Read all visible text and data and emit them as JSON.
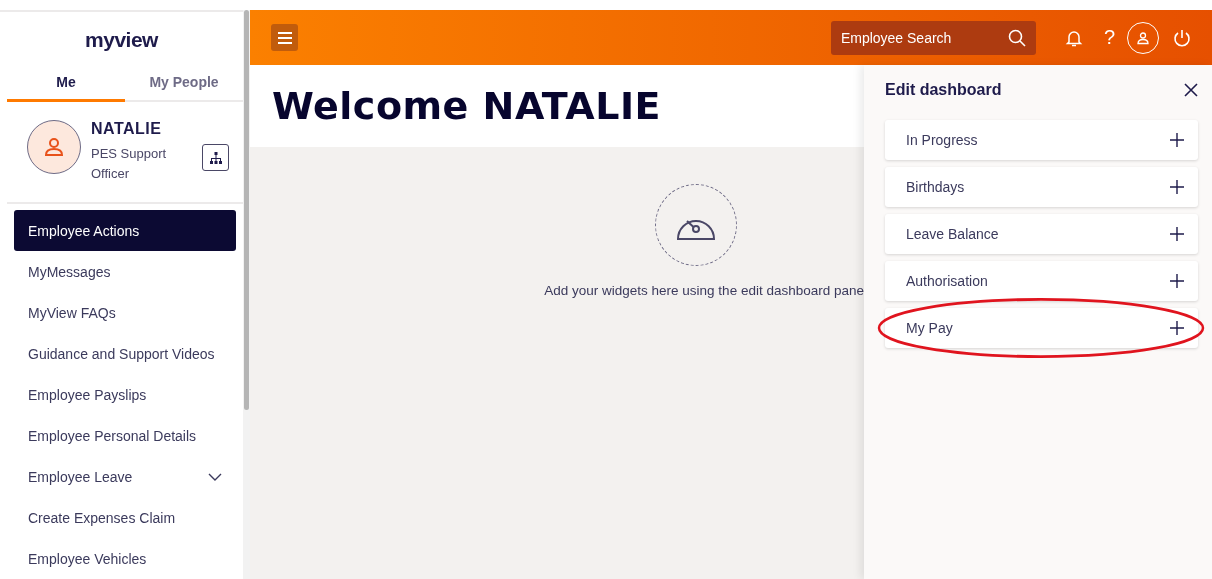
{
  "sidebar": {
    "logo": "myview",
    "tabs": [
      {
        "label": "Me",
        "selected": true
      },
      {
        "label": "My People",
        "selected": false
      }
    ],
    "profile": {
      "name": "NATALIE",
      "role": "PES Support Officer"
    },
    "items": [
      {
        "label": "Employee Actions",
        "selected": true,
        "expandable": false
      },
      {
        "label": "MyMessages",
        "selected": false,
        "expandable": false
      },
      {
        "label": "MyView FAQs",
        "selected": false,
        "expandable": false
      },
      {
        "label": "Guidance and Support Videos",
        "selected": false,
        "expandable": false
      },
      {
        "label": "Employee Payslips",
        "selected": false,
        "expandable": false
      },
      {
        "label": "Employee Personal Details",
        "selected": false,
        "expandable": false
      },
      {
        "label": "Employee Leave",
        "selected": false,
        "expandable": true
      },
      {
        "label": "Create Expenses Claim",
        "selected": false,
        "expandable": false
      },
      {
        "label": "Employee Vehicles",
        "selected": false,
        "expandable": false
      }
    ]
  },
  "header": {
    "search": {
      "placeholder": "Employee Search"
    },
    "help": "?"
  },
  "main": {
    "title": "Welcome NATALIE",
    "empty_message": "Add your widgets here using the edit dashboard pane"
  },
  "edit_panel": {
    "title": "Edit dashboard",
    "widgets": [
      {
        "label": "In Progress",
        "highlighted": false
      },
      {
        "label": "Birthdays",
        "highlighted": false
      },
      {
        "label": "Leave Balance",
        "highlighted": false
      },
      {
        "label": "Authorisation",
        "highlighted": false
      },
      {
        "label": "My Pay",
        "highlighted": true
      }
    ]
  }
}
